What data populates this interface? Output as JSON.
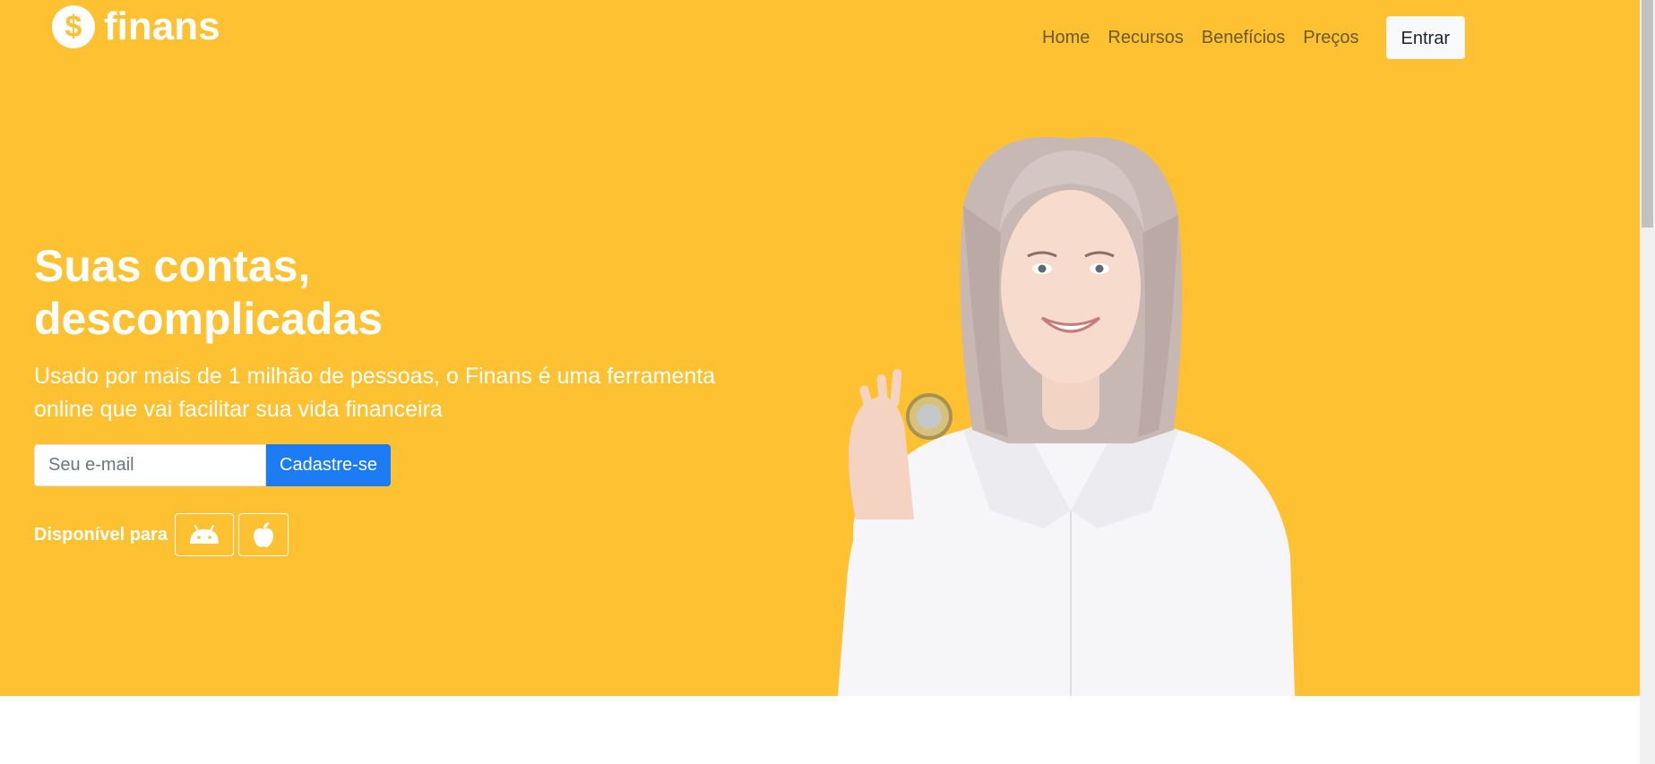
{
  "brand": {
    "icon_symbol": "$",
    "name": "finans"
  },
  "nav": {
    "links": [
      "Home",
      "Recursos",
      "Benefícios",
      "Preços"
    ],
    "login_label": "Entrar"
  },
  "hero": {
    "headline": "Suas contas, descomplicadas",
    "subtext": "Usado por mais de 1 milhão de pessoas, o Finans é uma ferramenta online que vai facilitar sua vida financeira",
    "email_placeholder": "Seu e-mail",
    "signup_label": "Cadastre-se",
    "available_label": "Disponível para",
    "store_icons": [
      "android-icon",
      "apple-icon"
    ]
  },
  "colors": {
    "hero_background": "#fdc132",
    "primary_button": "#1b7cf5",
    "text_light": "#ffffff",
    "nav_link": "#6b5a2a"
  }
}
